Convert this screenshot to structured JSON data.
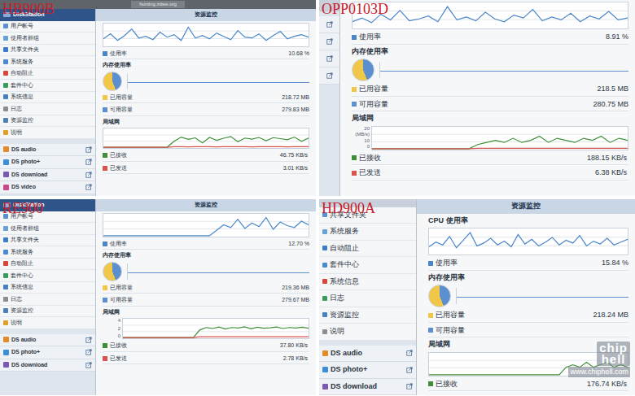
{
  "panels": [
    {
      "label": "HB900B",
      "kind": "full",
      "browser": {
        "address": "hunting.zdwe.org"
      },
      "sidebar": {
        "title": "DiskStation",
        "items": [
          "用户帐号",
          "使用者群组",
          "共享文件夹",
          "系统服务",
          "自动阻止",
          "套件中心",
          "系统信息",
          "日志",
          "资源监控",
          "说明"
        ],
        "apps": [
          "DS audio",
          "DS photo+",
          "DS download",
          "DS video"
        ]
      },
      "monitor": {
        "title": "资源监控",
        "cpu": {
          "title": "",
          "values": [
            8,
            14,
            6,
            12,
            20,
            9,
            11,
            7,
            16,
            10,
            13,
            6,
            22,
            9,
            12,
            8,
            15,
            11,
            7,
            18,
            10,
            9,
            14,
            6,
            12,
            17,
            8,
            11,
            13,
            10
          ],
          "legend": "使用率",
          "reading": "10.68 %"
        },
        "memory": {
          "title": "内存使用率",
          "level": 0.44,
          "used": {
            "label": "已用容量",
            "value": "218.72 MB"
          },
          "free": {
            "label": "可用容量",
            "value": "279.83 MB"
          }
        },
        "network": {
          "title": "局域网",
          "ticks": [],
          "series": [
            {
              "label": "已接收",
              "reading": "46.75 KB/s",
              "color": "#3f8f3a",
              "values": [
                0,
                0,
                0,
                0,
                0,
                0,
                0,
                0,
                0,
                0,
                30,
                52,
                40,
                48,
                22,
                50,
                35,
                46,
                55,
                28,
                47,
                41,
                50,
                33,
                49,
                44,
                38,
                52,
                30,
                47
              ]
            },
            {
              "label": "已发送",
              "reading": "3.01 KB/s",
              "color": "#d9534f",
              "values": [
                0,
                0,
                0,
                0,
                0,
                0,
                0,
                0,
                0,
                0,
                3,
                3,
                2,
                3,
                3,
                3,
                2,
                3,
                3,
                3,
                3,
                2,
                3,
                3,
                3,
                3,
                2,
                3,
                3,
                3
              ]
            }
          ]
        }
      }
    },
    {
      "label": "OPP0103D",
      "kind": "zoomed",
      "browser": {
        "address": ""
      },
      "sidebar": {
        "title": "",
        "items": [],
        "apps": [
          "",
          "",
          "",
          ""
        ]
      },
      "monitor": {
        "title": "",
        "cpu": {
          "title": "",
          "values": [
            6,
            10,
            5,
            14,
            8,
            18,
            7,
            9,
            12,
            6,
            22,
            8,
            11,
            7,
            16,
            9,
            6,
            13,
            10,
            19,
            7,
            11,
            8,
            15,
            6,
            12,
            9,
            17,
            8,
            10
          ],
          "legend": "使用率",
          "reading": "8.91 %"
        },
        "memory": {
          "title": "内存使用率",
          "level": 0.44,
          "used": {
            "label": "已用容量",
            "value": "218.5 MB"
          },
          "free": {
            "label": "可用容量",
            "value": "280.75 MB"
          }
        },
        "network": {
          "title": "局域网",
          "ticks": [
            "20",
            "(MB/s)",
            "10",
            "0"
          ],
          "series": [
            {
              "label": "已接收",
              "reading": "188.15 KB/s",
              "color": "#3f8f3a",
              "values": [
                0,
                0,
                0,
                0,
                0,
                0,
                0,
                0,
                0,
                0,
                0,
                0,
                2,
                3,
                4,
                3,
                5,
                3,
                4,
                6,
                3,
                5,
                4,
                3,
                5,
                4,
                6,
                3,
                5,
                4
              ]
            },
            {
              "label": "已发送",
              "reading": "6.38 KB/s",
              "color": "#d9534f",
              "values": [
                0,
                0,
                0,
                0,
                0,
                0,
                0,
                0,
                0,
                0,
                0,
                0,
                0.2,
                0.2,
                0.2,
                0.2,
                0.2,
                0.2,
                0.2,
                0.2,
                0.2,
                0.2,
                0.2,
                0.2,
                0.2,
                0.2,
                0.2,
                0.2,
                0.2,
                0.2
              ]
            }
          ]
        }
      }
    },
    {
      "label": "RE900",
      "kind": "full",
      "browser": {
        "address": ""
      },
      "sidebar": {
        "title": "DiskStation",
        "items": [
          "用户帐号",
          "使用者群组",
          "共享文件夹",
          "系统服务",
          "自动阻止",
          "套件中心",
          "系统信息",
          "日志",
          "资源监控",
          "说明"
        ],
        "apps": [
          "DS audio",
          "DS photo+",
          "DS download"
        ]
      },
      "monitor": {
        "title": "资源监控",
        "cpu": {
          "title": "",
          "values": [
            0,
            0,
            0,
            0,
            0,
            0,
            0,
            0,
            0,
            0,
            0,
            0,
            0,
            0,
            0,
            0,
            6,
            12,
            9,
            18,
            8,
            14,
            10,
            20,
            7,
            15,
            11,
            9,
            16,
            12
          ],
          "legend": "使用率",
          "reading": "12.70 %"
        },
        "memory": {
          "title": "内存使用率",
          "level": 0.44,
          "used": {
            "label": "已用容量",
            "value": "219.36 MB"
          },
          "free": {
            "label": "可用容量",
            "value": "279.67 MB"
          }
        },
        "network": {
          "title": "局域网",
          "ticks": [
            "4",
            "2",
            "0"
          ],
          "series": [
            {
              "label": "已接收",
              "reading": "37.80 KB/s",
              "color": "#3f8f3a",
              "values": [
                0,
                0,
                0,
                0,
                0,
                0,
                0,
                0,
                0,
                0,
                0,
                0,
                30,
                40,
                36,
                42,
                34,
                40,
                38,
                43,
                35,
                41,
                37,
                39,
                42,
                36,
                40,
                38,
                41,
                37
              ]
            },
            {
              "label": "已发送",
              "reading": "2.78 KB/s",
              "color": "#d9534f",
              "values": [
                0,
                0,
                0,
                0,
                0,
                0,
                0,
                0,
                0,
                0,
                0,
                0,
                3,
                3,
                3,
                3,
                3,
                3,
                3,
                3,
                3,
                3,
                3,
                3,
                3,
                3,
                3,
                3,
                3,
                3
              ]
            }
          ]
        }
      }
    },
    {
      "label": "HD900A",
      "kind": "zoomed",
      "browser": {
        "address": ""
      },
      "sidebar": {
        "title": "",
        "items": [
          "共享文件夹",
          "系统服务",
          "自动阻止",
          "套件中心",
          "系统信息",
          "日志",
          "资源监控",
          "说明"
        ],
        "apps": [
          "DS audio",
          "DS photo+",
          "DS download"
        ]
      },
      "monitor": {
        "title": "资源监控",
        "cpu": {
          "title": "CPU 使用率",
          "values": [
            7,
            12,
            9,
            18,
            6,
            14,
            22,
            8,
            11,
            16,
            9,
            13,
            7,
            20,
            10,
            15,
            8,
            12,
            17,
            9,
            14,
            11,
            19,
            8,
            13,
            10,
            16,
            9,
            12,
            15
          ],
          "legend": "使用率",
          "reading": "15.84 %"
        },
        "memory": {
          "title": "内存使用率",
          "level": 0.44,
          "used": {
            "label": "已用容量",
            "value": "218.24 MB"
          },
          "free": {
            "label": "可用容量",
            "value": ""
          }
        },
        "network": {
          "title": "局域网",
          "ticks": [],
          "series": [
            {
              "label": "已接收",
              "reading": "176.74 KB/s",
              "color": "#3f8f3a",
              "values": [
                0,
                0,
                0,
                0,
                0,
                0,
                0,
                0,
                0,
                0,
                0,
                0,
                0,
                0,
                0,
                0,
                0,
                0,
                0,
                0,
                3,
                4,
                3,
                5,
                3,
                4,
                5,
                3,
                4,
                3
              ]
            }
          ]
        }
      }
    }
  ],
  "watermark": {
    "logo_top": "chip",
    "logo_bottom": "hell",
    "url": "www.chiphell.com"
  }
}
